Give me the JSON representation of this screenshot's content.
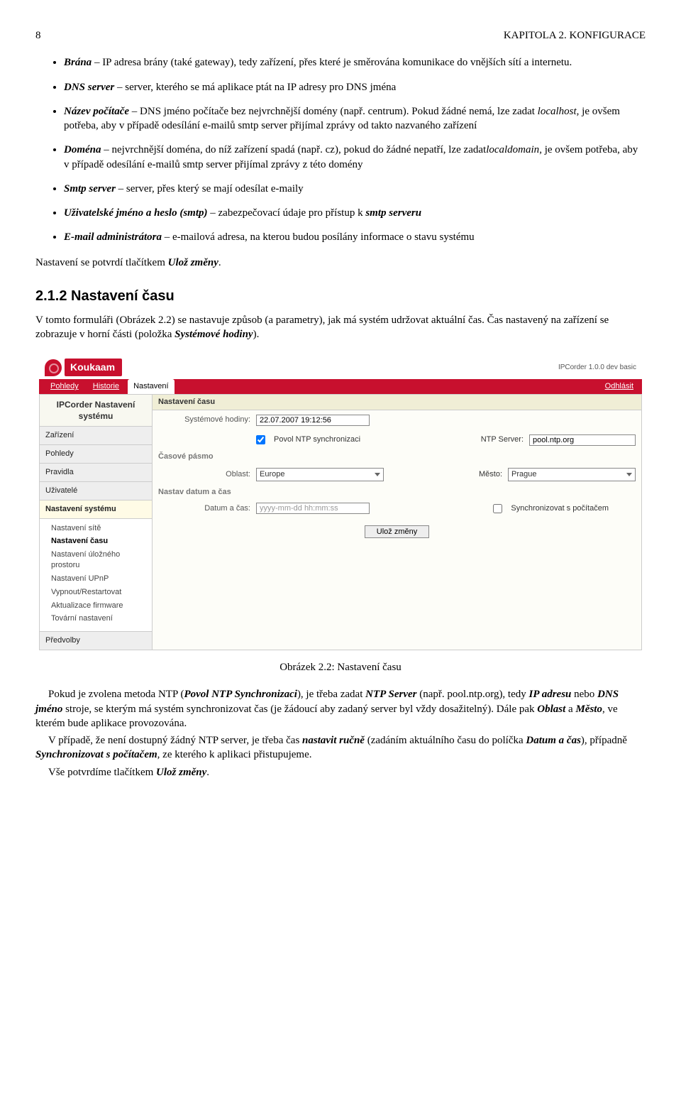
{
  "page": {
    "num": "8",
    "header": "KAPITOLA 2. KONFIGURACE"
  },
  "bullets": {
    "b1": {
      "term": "Brána",
      "text": " – IP adresa brány (také gateway), tedy zařízení, přes které je směrována komunikace do vnějších sítí a internetu."
    },
    "b2": {
      "term": "DNS server",
      "text": " – server, kterého se má aplikace ptát na IP adresy pro DNS jména"
    },
    "b3": {
      "term": "Název počítače",
      "text1": " – DNS jméno počítače bez nejvrchnější domény (např. centrum). Pokud žádné nemá, lze zadat ",
      "it": "localhost",
      "text2": ", je ovšem potřeba, aby v případě odesílání e-mailů smtp server přijímal zprávy od takto nazvaného zařízení"
    },
    "b4": {
      "term": "Doména",
      "text1": " – nejvrchnější doména, do níž zařízení spadá (např. cz), pokud do žádné nepatří, lze zadat",
      "it": "localdomain",
      "text2": ", je ovšem potřeba, aby v případě odesílání e-mailů smtp server přijímal zprávy z této domény"
    },
    "b5": {
      "term": "Smtp server",
      "text": " – server, přes který se mají odesílat e-maily"
    },
    "b6": {
      "term": "Uživatelské jméno a heslo (smtp)",
      "text": " – zabezpečovací údaje pro přístup k ",
      "term2": "smtp serveru"
    },
    "b7": {
      "term": "E-mail administrátora",
      "text": " – e-mailová adresa, na kterou budou posílány informace o stavu systému"
    }
  },
  "p1a": "Nastavení se potvrdí tlačítkem ",
  "p1b": "Ulož změny",
  "p1c": ".",
  "sec": "2.1.2   Nastavení času",
  "p2a": "V tomto formuláři (Obrázek 2.2) se nastavuje způsob (a parametry), jak má systém udržovat aktuální čas. Čas nastavený na zařízení se zobrazuje v horní části (položka ",
  "p2b": "Systémové hodiny",
  "p2c": ").",
  "shot": {
    "logo": "Koukaam",
    "version": "IPCorder 1.0.0 dev basic",
    "tabs": {
      "t1": "Pohledy",
      "t2": "Historie",
      "t3": "Nastavení",
      "logout": "Odhlásit"
    },
    "sidebar": {
      "title": "IPCorder Nastavení systému",
      "i1": "Zařízení",
      "i2": "Pohledy",
      "i3": "Pravidla",
      "i4": "Uživatelé",
      "i5": "Nastavení systému",
      "sub1": "Nastavení sítě",
      "sub2": "Nastavení času",
      "sub3": "Nastavení úložného prostoru",
      "sub4": "Nastavení UPnP",
      "sub5": "Vypnout/Restartovat",
      "sub6": "Aktualizace firmware",
      "sub7": "Tovární nastavení",
      "i6": "Předvolby"
    },
    "content": {
      "title": "Nastavení času",
      "clock_lab": "Systémové hodiny:",
      "clock_val": "22.07.2007 19:12:56",
      "ntp_lab": "Povol NTP synchronizaci",
      "ntpsrv_lab": "NTP Server:",
      "ntpsrv_val": "pool.ntp.org",
      "tz_title": "Časové pásmo",
      "region_lab": "Oblast:",
      "region_val": "Europe",
      "city_lab": "Město:",
      "city_val": "Prague",
      "dt_title": "Nastav datum a čas",
      "dt_lab": "Datum a čas:",
      "dt_ph": "yyyy-mm-dd hh:mm:ss",
      "sync_lab": "Synchronizovat s počítačem",
      "save": "Ulož změny"
    }
  },
  "caption": "Obrázek 2.2: Nastavení času",
  "p3": {
    "a": "Pokud je zvolena metoda NTP (",
    "b": "Povol NTP Synchronizaci",
    "c": "), je třeba zadat ",
    "d": "NTP Server",
    "e": " (např. pool.ntp.org), tedy ",
    "f": "IP adresu",
    "g": " nebo ",
    "h": "DNS jméno",
    "i": " stroje, se kterým má systém synchronizovat čas (je žádoucí aby zadaný server byl vždy dosažitelný). Dále pak ",
    "j": "Oblast",
    "k": " a ",
    "l": "Město",
    "m": ", ve kterém bude aplikace provozována."
  },
  "p4": {
    "a": "V případě, že není dostupný žádný NTP server, je třeba čas ",
    "b": "nastavit ručně",
    "c": " (zadáním aktuálního času do políčka ",
    "d": "Datum a čas",
    "e": "), případně ",
    "f": "Synchronizovat s počítačem",
    "g": ", ze kterého k aplikaci přistupujeme."
  },
  "p5": {
    "a": "Vše potvrdíme tlačítkem ",
    "b": "Ulož změny",
    "c": "."
  }
}
